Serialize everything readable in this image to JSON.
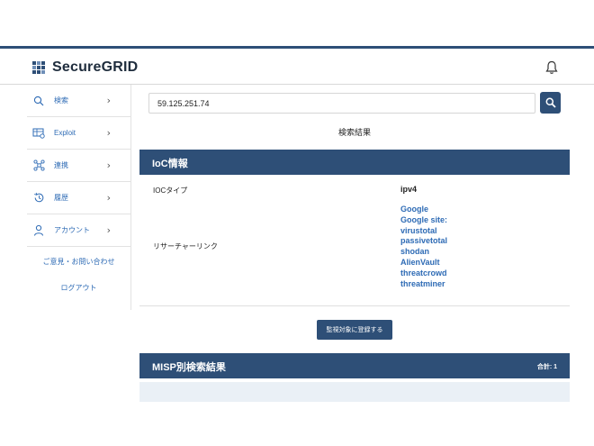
{
  "app": {
    "name": "SecureGRID"
  },
  "sidebar": {
    "items": [
      {
        "label": "検索",
        "icon": "search-icon"
      },
      {
        "label": "Exploit",
        "icon": "exploit-icon"
      },
      {
        "label": "連携",
        "icon": "network-icon"
      },
      {
        "label": "履歴",
        "icon": "history-icon"
      },
      {
        "label": "アカウント",
        "icon": "user-icon"
      }
    ],
    "contact_label": "ご意見・お問い合わせ",
    "logout_label": "ログアウト"
  },
  "search": {
    "value": "59.125.251.74"
  },
  "results": {
    "title": "検索結果",
    "ioc_section_title": "IoC情報",
    "ioc_type_label": "IOCタイプ",
    "ioc_type_value": "ipv4",
    "research_links_label": "リサーチャーリンク",
    "research_links": [
      "Google",
      "Google site:",
      "virustotal",
      "passivetotal",
      "shodan",
      "AlienVault",
      "threatcrowd",
      "threatminer"
    ],
    "register_button": "監視対象に登録する",
    "misp_section_title": "MISP別検索結果",
    "misp_total": "合計: 1"
  },
  "colors": {
    "primary": "#2e4f77",
    "link": "#2e6bb5"
  }
}
